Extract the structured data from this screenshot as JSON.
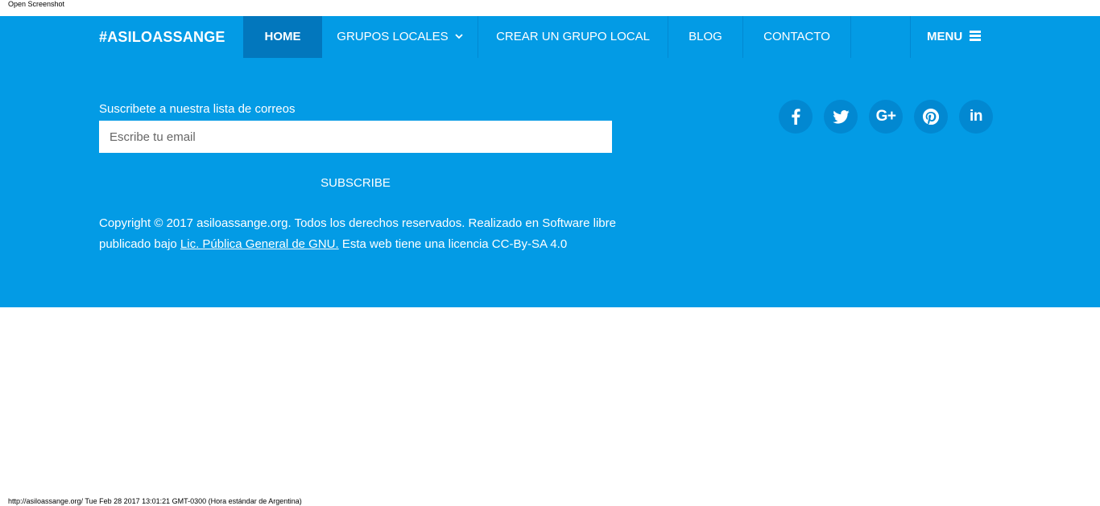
{
  "top": {
    "open_screenshot": "Open Screenshot"
  },
  "nav": {
    "brand": "#ASILOASSANGE",
    "items": [
      {
        "label": "HOME",
        "active": true
      },
      {
        "label": "GRUPOS LOCALES",
        "has_dropdown": true
      },
      {
        "label": "CREAR UN GRUPO LOCAL"
      },
      {
        "label": "BLOG"
      },
      {
        "label": "CONTACTO"
      }
    ],
    "menu_label": "MENU"
  },
  "newsletter": {
    "label": "Suscribete a nuestra lista de correos",
    "placeholder": "Escribe tu email",
    "button": "SUBSCRIBE"
  },
  "footer": {
    "copyright_pre": "Copyright © 2017 asiloassange.org. Todos los derechos reservados. Realizado en Software libre publicado bajo ",
    "license_link": "Lic. Pública General de GNU.",
    "copyright_post": " Esta web tiene una licencia CC-By-SA 4.0"
  },
  "social": [
    {
      "icon": "facebook-icon"
    },
    {
      "icon": "twitter-icon"
    },
    {
      "icon": "google-plus-icon",
      "text": "G+"
    },
    {
      "icon": "pinterest-icon"
    },
    {
      "icon": "linkedin-icon",
      "text": "in"
    }
  ],
  "colors": {
    "background": "#039be5",
    "active_nav": "#0277bd",
    "social_circle": "#0288d1"
  },
  "status": {
    "text": "http://asiloassange.org/ Tue Feb 28 2017 13:01:21 GMT-0300 (Hora estándar de Argentina)"
  }
}
